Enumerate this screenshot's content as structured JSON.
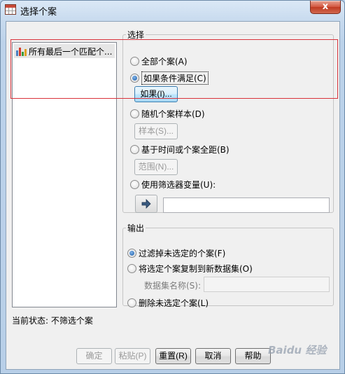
{
  "window": {
    "title": "选择个案",
    "close_symbol": "x"
  },
  "variable_list": {
    "items": [
      {
        "label": "所有最后一个匹配个..."
      }
    ]
  },
  "select_group": {
    "title": "选择",
    "options": [
      {
        "label": "全部个案(A)",
        "checked": false,
        "enabled": true
      },
      {
        "label": "如果条件满足(C)",
        "checked": true,
        "enabled": true
      },
      {
        "label": "随机个案样本(D)",
        "checked": false,
        "enabled": true
      },
      {
        "label": "基于时间或个案全距(B)",
        "checked": false,
        "enabled": true
      },
      {
        "label": "使用筛选器变量(U):",
        "checked": false,
        "enabled": true
      }
    ],
    "if_button": "如果(I)...",
    "sample_button": "样本(S)...",
    "range_button": "范围(N)...",
    "filter_variable_value": ""
  },
  "output_group": {
    "title": "输出",
    "options": [
      {
        "label": "过滤掉未选定的个案(F)",
        "checked": true
      },
      {
        "label": "将选定个案复制到新数据集(O)",
        "checked": false
      },
      {
        "label": "删除未选定个案(L)",
        "checked": false
      }
    ],
    "dataset_name_label": "数据集名称(S):",
    "dataset_name_value": ""
  },
  "status": {
    "text": "当前状态: 不筛选个案"
  },
  "buttons": {
    "ok": "确定",
    "paste": "粘贴(P)",
    "reset": "重置(R)",
    "cancel": "取消",
    "help": "帮助"
  },
  "watermark": "Baidu 经验",
  "colors": {
    "accent": "#1e5fa8",
    "highlight_box": "#d9333b",
    "close_button": "#c03a22"
  }
}
